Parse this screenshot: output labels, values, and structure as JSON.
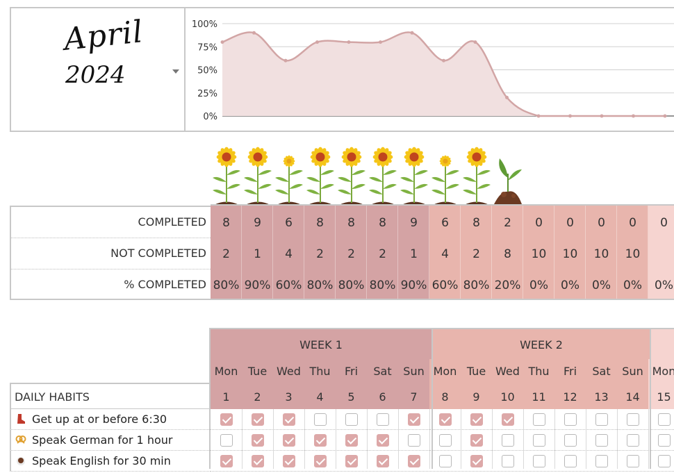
{
  "header": {
    "month": "April",
    "year": "2024"
  },
  "colors": {
    "week1": "#d4a3a4",
    "week2": "#e8b5ad",
    "week3": "#f6d4d0",
    "check": "#dda8a8",
    "chart_line": "#d2a5a5",
    "chart_fill": "#f1e0e0"
  },
  "chart_data": {
    "type": "area",
    "y_ticks": [
      "100%",
      "75%",
      "50%",
      "25%",
      "0%"
    ],
    "ylim": [
      0,
      100
    ],
    "x": [
      1,
      2,
      3,
      4,
      5,
      6,
      7,
      8,
      9,
      10,
      11,
      12,
      13,
      14,
      15
    ],
    "values": [
      80,
      90,
      60,
      80,
      80,
      80,
      90,
      60,
      80,
      20,
      0,
      0,
      0,
      0,
      0
    ]
  },
  "flowers": [
    "sunflower",
    "sunflower",
    "small-flower",
    "sunflower",
    "sunflower",
    "sunflower",
    "sunflower",
    "small-flower",
    "sunflower",
    "sprout"
  ],
  "summary": {
    "labels": {
      "completed": "COMPLETED",
      "not_completed": "NOT COMPLETED",
      "pct": "% COMPLETED"
    },
    "completed": [
      "8",
      "9",
      "6",
      "8",
      "8",
      "8",
      "9",
      "6",
      "8",
      "2",
      "0",
      "0",
      "0",
      "0",
      "0"
    ],
    "not_completed": [
      "2",
      "1",
      "4",
      "2",
      "2",
      "2",
      "1",
      "4",
      "2",
      "8",
      "10",
      "10",
      "10",
      "10",
      ""
    ],
    "pct": [
      "80%",
      "90%",
      "60%",
      "80%",
      "80%",
      "80%",
      "90%",
      "60%",
      "80%",
      "20%",
      "0%",
      "0%",
      "0%",
      "0%",
      "0%"
    ]
  },
  "weeks": [
    "WEEK 1",
    "WEEK 2"
  ],
  "days": [
    "Mon",
    "Tue",
    "Wed",
    "Thu",
    "Fri",
    "Sat",
    "Sun",
    "Mon",
    "Tue",
    "Wed",
    "Thu",
    "Fri",
    "Sat",
    "Sun",
    "Mon"
  ],
  "dates": [
    "1",
    "2",
    "3",
    "4",
    "5",
    "6",
    "7",
    "8",
    "9",
    "10",
    "11",
    "12",
    "13",
    "14",
    "15"
  ],
  "habits_title": "DAILY HABITS",
  "habits": [
    {
      "icon": "boot-icon",
      "name": "Get up at or before 6:30",
      "checks": [
        1,
        1,
        1,
        0,
        0,
        0,
        1,
        1,
        1,
        1,
        0,
        0,
        0,
        0,
        0
      ]
    },
    {
      "icon": "pretzel-icon",
      "name": "Speak German for 1 hour",
      "checks": [
        0,
        1,
        1,
        1,
        1,
        1,
        0,
        0,
        1,
        0,
        0,
        0,
        0,
        0,
        0
      ]
    },
    {
      "icon": "tea-icon",
      "name": "Speak English for 30 min",
      "checks": [
        1,
        1,
        1,
        1,
        1,
        1,
        1,
        0,
        1,
        0,
        0,
        0,
        0,
        0,
        0
      ]
    }
  ]
}
